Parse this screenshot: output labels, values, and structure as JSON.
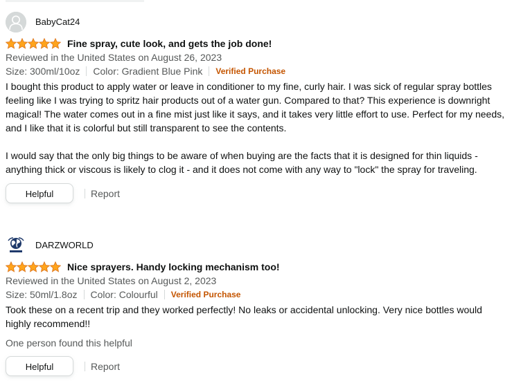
{
  "colors": {
    "star": "#FFA41C",
    "star_outline": "#DE7921",
    "verified": "#C45500",
    "secondary_text": "#565959",
    "primary_text": "#0F1111"
  },
  "reviews": [
    {
      "profile_name": "BabyCat24",
      "avatar_icon": "default-user-icon",
      "rating": 5,
      "title": "Fine spray, cute look, and gets the job done!",
      "date": "Reviewed in the United States on August 26, 2023",
      "size": "Size: 300ml/10oz",
      "color": "Color: Gradient Blue Pink",
      "verified": "Verified Purchase",
      "body": [
        "I bought this product to apply water or leave in conditioner to my fine, curly hair. I was sick of regular spray bottles feeling like I was trying to spritz hair products out of a water gun. Compared to that? This experience is downright magical! The water comes out in a fine mist just like it says, and it takes very little effort to use. Perfect for my needs, and I like that it is colorful but still transparent to see the contents.",
        "I would say that the only big things to be aware of when buying are the facts that it is designed for thin liquids - anything thick or viscous is likely to clog it - and it does not come with any way to \"lock\" the spray for traveling."
      ],
      "helpful_count": "",
      "helpful_label": "Helpful",
      "report_label": "Report"
    },
    {
      "profile_name": "DARZWORLD",
      "avatar_icon": "globe-avatar-icon",
      "rating": 5,
      "title": "Nice sprayers. Handy locking mechanism too!",
      "date": "Reviewed in the United States on August 2, 2023",
      "size": "Size: 50ml/1.8oz",
      "color": "Color: Colourful",
      "verified": "Verified Purchase",
      "body": [
        "Took these on a recent trip and they worked perfectly! No leaks or accidental unlocking. Very nice bottles would highly recommend!!"
      ],
      "helpful_count": "One person found this helpful",
      "helpful_label": "Helpful",
      "report_label": "Report"
    }
  ]
}
